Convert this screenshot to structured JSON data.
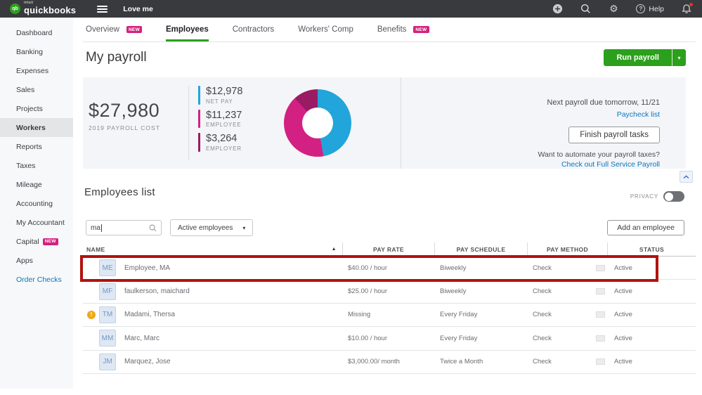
{
  "colors": {
    "brand_green": "#2ca01c",
    "badge_pink": "#d4217f",
    "link_blue": "#0a77c0",
    "topbar_bg": "#393a3d",
    "panel_bg": "#f4f5f8",
    "highlight_red": "#b2120e"
  },
  "icons": {
    "gear": "⚙",
    "help_mark": "?",
    "chevron_down": "▾",
    "sort_ascending": "▲",
    "warning_mark": "!"
  },
  "topbar": {
    "brand_prefix": "intuit",
    "brand": "quickbooks",
    "brand_mark": "qb",
    "company": "Love me",
    "help_label": "Help"
  },
  "sidebar": {
    "items": [
      {
        "label": "Dashboard"
      },
      {
        "label": "Banking"
      },
      {
        "label": "Expenses"
      },
      {
        "label": "Sales"
      },
      {
        "label": "Projects"
      },
      {
        "label": "Workers"
      },
      {
        "label": "Reports"
      },
      {
        "label": "Taxes"
      },
      {
        "label": "Mileage"
      },
      {
        "label": "Accounting"
      },
      {
        "label": "My Accountant"
      },
      {
        "label": "Capital",
        "badge": "NEW"
      },
      {
        "label": "Apps"
      },
      {
        "label": "Order Checks"
      }
    ]
  },
  "tabs": [
    {
      "label": "Overview",
      "badge": "NEW"
    },
    {
      "label": "Employees"
    },
    {
      "label": "Contractors"
    },
    {
      "label": "Workers' Comp"
    },
    {
      "label": "Benefits",
      "badge": "NEW"
    }
  ],
  "page": {
    "title": "My payroll",
    "run_payroll": "Run payroll"
  },
  "summary": {
    "total": "$27,980",
    "total_caption": "2019 PAYROLL COST",
    "legend": [
      {
        "value": "$12,978",
        "label": "NET PAY",
        "color": "#22a5da"
      },
      {
        "value": "$11,237",
        "label": "EMPLOYEE",
        "color": "#d32083"
      },
      {
        "value": "$3,264",
        "label": "EMPLOYER",
        "color": "#9a1b64"
      }
    ]
  },
  "chart_data": {
    "type": "pie",
    "donut": true,
    "title": "2019 payroll cost breakdown",
    "categories": [
      "Net pay",
      "Employee",
      "Employer"
    ],
    "values": [
      12978,
      11237,
      3264
    ],
    "colors": [
      "#22a5da",
      "#d32083",
      "#9a1b64"
    ],
    "center_total": "$27,980",
    "legend_position": "left"
  },
  "payroll_panel": {
    "due_text": "Next payroll due tomorrow, 11/21",
    "paycheck_link": "Paycheck list",
    "finish_button": "Finish payroll tasks",
    "automate_text": "Want to automate your payroll taxes?",
    "automate_link": "Check out Full Service Payroll"
  },
  "employees": {
    "heading": "Employees list",
    "privacy_label": "PRIVACY",
    "search_value": "ma",
    "filter_value": "Active employees",
    "add_button": "Add an employee",
    "columns": [
      "NAME",
      "PAY RATE",
      "PAY SCHEDULE",
      "PAY METHOD",
      "STATUS"
    ],
    "rows": [
      {
        "initials": "ME",
        "name": "Employee, MA",
        "pay_rate": "$40.00 / hour",
        "pay_schedule": "Biweekly",
        "pay_method": "Check",
        "status": "Active"
      },
      {
        "initials": "MF",
        "name": "faulkerson, maichard",
        "pay_rate": "$25.00 / hour",
        "pay_schedule": "Biweekly",
        "pay_method": "Check",
        "status": "Active"
      },
      {
        "initials": "TM",
        "name": "Madami, Thersa",
        "pay_rate": "Missing",
        "pay_schedule": "Every Friday",
        "pay_method": "Check",
        "status": "Active"
      },
      {
        "initials": "MM",
        "name": "Marc, Marc",
        "pay_rate": "$10.00 / hour",
        "pay_schedule": "Every Friday",
        "pay_method": "Check",
        "status": "Active"
      },
      {
        "initials": "JM",
        "name": "Marquez, Jose",
        "pay_rate": "$3,000.00/ month",
        "pay_schedule": "Twice a Month",
        "pay_method": "Check",
        "status": "Active"
      }
    ]
  }
}
